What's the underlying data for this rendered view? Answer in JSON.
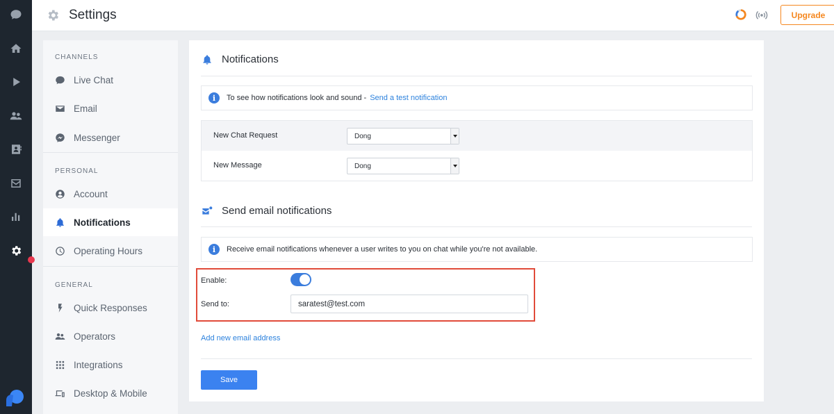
{
  "app": {
    "title": "Settings"
  },
  "topbar": {
    "upgrade_label": "Upgrade"
  },
  "subnav": {
    "channels_title": "CHANNELS",
    "personal_title": "PERSONAL",
    "general_title": "GENERAL",
    "items": [
      {
        "label": "Live Chat",
        "icon": "chat-bubble-icon"
      },
      {
        "label": "Email",
        "icon": "envelope-icon"
      },
      {
        "label": "Messenger",
        "icon": "messenger-icon"
      },
      {
        "label": "Account",
        "icon": "account-icon"
      },
      {
        "label": "Notifications",
        "icon": "bell-icon"
      },
      {
        "label": "Operating Hours",
        "icon": "clock-icon"
      },
      {
        "label": "Quick Responses",
        "icon": "bolt-icon"
      },
      {
        "label": "Operators",
        "icon": "people-icon"
      },
      {
        "label": "Integrations",
        "icon": "grid-icon"
      },
      {
        "label": "Desktop & Mobile",
        "icon": "devices-icon"
      }
    ]
  },
  "notifications": {
    "heading": "Notifications",
    "info_text": "To see how notifications look and sound -",
    "info_link": "Send a test notification",
    "rows": [
      {
        "label": "New Chat Request",
        "value": "Dong"
      },
      {
        "label": "New Message",
        "value": "Dong"
      }
    ]
  },
  "email_notifications": {
    "heading": "Send email notifications",
    "info_text": "Receive email notifications whenever a user writes to you on chat while you're not available.",
    "enable_label": "Enable:",
    "enabled": true,
    "send_to_label": "Send to:",
    "send_to_value": "saratest@test.com",
    "add_link": "Add new email address",
    "save_label": "Save"
  },
  "colors": {
    "accent": "#3b7ddd",
    "upgrade": "#f5871f",
    "highlight": "#e14b3a",
    "rail": "#1e262f"
  }
}
